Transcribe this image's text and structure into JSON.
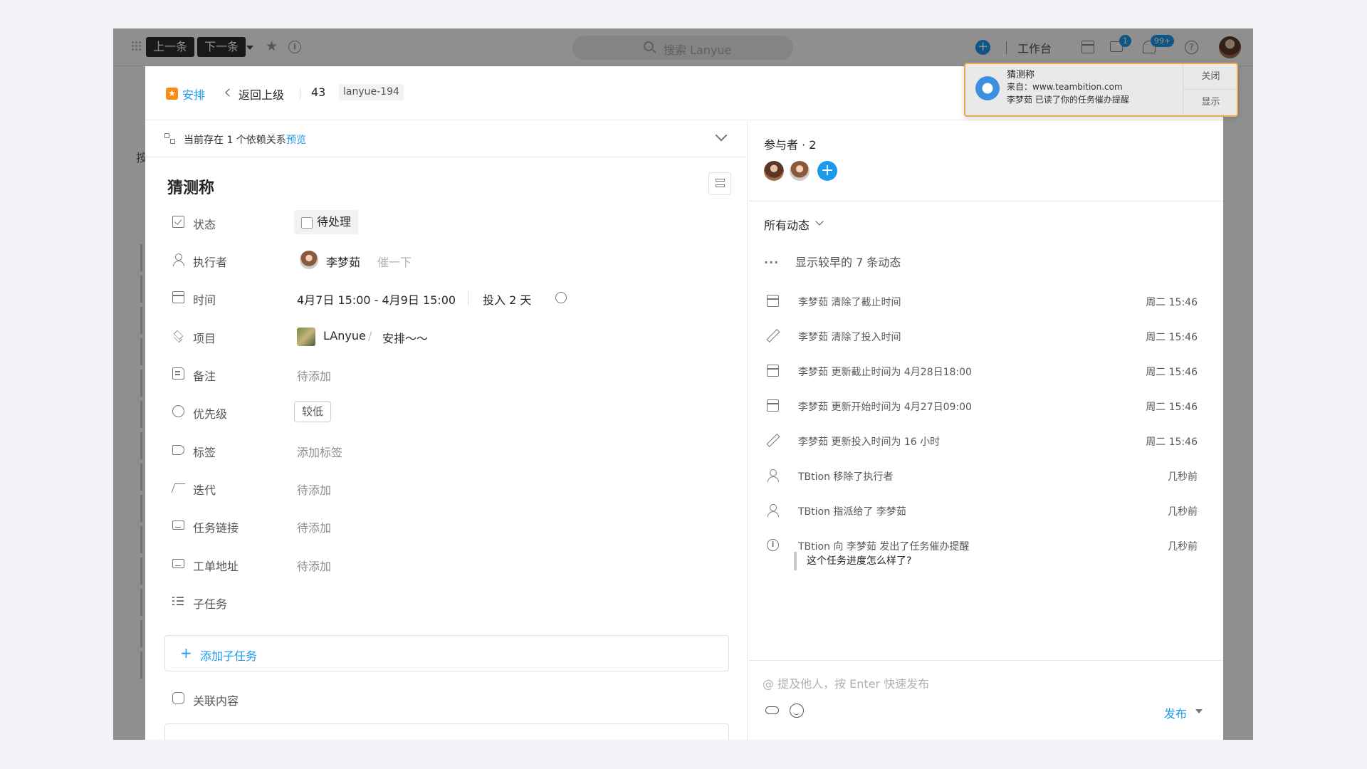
{
  "topbar": {
    "prev_label": "上一条",
    "next_label": "下一条",
    "search_placeholder": "搜索 Lanyue",
    "workbench_label": "工作台",
    "message_badge": "1",
    "notify_badge": "99+",
    "help_glyph": "?"
  },
  "background": {
    "left_text": "按"
  },
  "header": {
    "task_type": "安排",
    "back_label": "返回上级",
    "task_number": "43",
    "task_id": "lanyue-194"
  },
  "dependency": {
    "text": "当前存在 1 个依赖关系",
    "link": "预览"
  },
  "task": {
    "title": "猜测称",
    "fields": {
      "status": {
        "label": "状态",
        "value": "待处理"
      },
      "assignee": {
        "label": "执行者",
        "value": "李梦茹",
        "remind": "催一下"
      },
      "time": {
        "label": "时间",
        "value": "4月7日 15:00 - 4月9日 15:00",
        "invest": "投入 2 天"
      },
      "project": {
        "label": "项目",
        "value": "LAnyue",
        "separator": "/",
        "sub": "安排～～"
      },
      "note": {
        "label": "备注",
        "value": "待添加"
      },
      "priority": {
        "label": "优先级",
        "value": "较低"
      },
      "tags": {
        "label": "标签",
        "value": "添加标签"
      },
      "iteration": {
        "label": "迭代",
        "value": "待添加"
      },
      "task_link": {
        "label": "任务链接",
        "value": "待添加"
      },
      "ticket_url": {
        "label": "工单地址",
        "value": "待添加"
      },
      "subtasks": {
        "label": "子任务"
      }
    },
    "add_subtask": "添加子任务",
    "related": "关联内容"
  },
  "participants": {
    "title": "参与者 · 2"
  },
  "activity": {
    "filter": "所有动态",
    "earlier": "显示较早的 7 条动态",
    "items": [
      {
        "icon": "calendar-icon",
        "text": "李梦茹 清除了截止时间",
        "time": "周二 15:46"
      },
      {
        "icon": "pencil-icon",
        "text": "李梦茹 清除了投入时间",
        "time": "周二 15:46"
      },
      {
        "icon": "calendar-icon",
        "text": "李梦茹 更新截止时间为 4月28日18:00",
        "time": "周二 15:46"
      },
      {
        "icon": "calendar-icon",
        "text": "李梦茹 更新开始时间为 4月27日09:00",
        "time": "周二 15:46"
      },
      {
        "icon": "pencil-icon",
        "text": "李梦茹 更新投入时间为 16 小时",
        "time": "周二 15:46"
      },
      {
        "icon": "user-icon",
        "text": "TBtion 移除了执行者",
        "time": "几秒前"
      },
      {
        "icon": "user-icon",
        "text": "TBtion 指派给了 李梦茹",
        "time": "几秒前"
      },
      {
        "icon": "info-icon",
        "text": "TBtion 向 李梦茹 发出了任务催办提醒",
        "time": "几秒前"
      }
    ],
    "quote": "这个任务进度怎么样了?"
  },
  "composer": {
    "placeholder": "@ 提及他人，按 Enter 快速发布",
    "publish": "发布"
  },
  "notification": {
    "title": "猜测称",
    "from": "来自：www.teambition.com",
    "body": "李梦茹 已读了你的任务催办提醒",
    "close": "关闭",
    "show": "显示"
  },
  "colors": {
    "accent": "#1b9aee",
    "star": "#fa8c16",
    "notification_border": "#f0a850"
  }
}
